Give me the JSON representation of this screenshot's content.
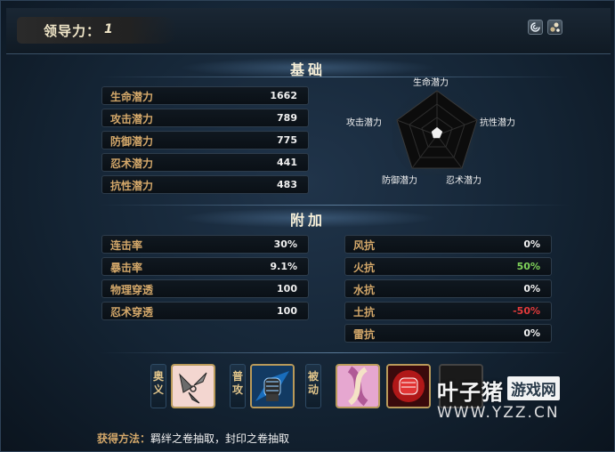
{
  "header": {
    "leader_label": "领导力：",
    "leader_value": "1",
    "icons": [
      "swirl-icon",
      "stones-icon"
    ]
  },
  "sections": {
    "basic_title": "基础",
    "extra_title": "附加"
  },
  "basic_stats": [
    {
      "label": "生命潜力",
      "value": "1662"
    },
    {
      "label": "攻击潜力",
      "value": "789"
    },
    {
      "label": "防御潜力",
      "value": "775"
    },
    {
      "label": "忍术潜力",
      "value": "441"
    },
    {
      "label": "抗性潜力",
      "value": "483"
    }
  ],
  "radar": {
    "labels": {
      "top": "生命潜力",
      "left": "攻击潜力",
      "right": "抗性潜力",
      "bottom_left": "防御潜力",
      "bottom_right": "忍术潜力"
    }
  },
  "extra_left": [
    {
      "label": "连击率",
      "value": "30%"
    },
    {
      "label": "暴击率",
      "value": "9.1%"
    },
    {
      "label": "物理穿透",
      "value": "100"
    },
    {
      "label": "忍术穿透",
      "value": "100"
    }
  ],
  "extra_right": [
    {
      "label": "风抗",
      "value": "0%",
      "color": "#f0f0f0"
    },
    {
      "label": "火抗",
      "value": "50%",
      "color": "#7fd35a"
    },
    {
      "label": "水抗",
      "value": "0%",
      "color": "#f0f0f0"
    },
    {
      "label": "土抗",
      "value": "-50%",
      "color": "#e23a3a"
    },
    {
      "label": "雷抗",
      "value": "0%",
      "color": "#f0f0f0"
    }
  ],
  "skills": {
    "ougi_tag": "奥义",
    "normal_tag": "普攻",
    "passive_tag": "被动"
  },
  "acquire": {
    "label": "获得方法：",
    "value": "羁绊之卷抽取，封印之卷抽取"
  },
  "watermark": {
    "name": "叶子猪",
    "box": "游戏网",
    "url": "WWW.YZZ.CN"
  }
}
